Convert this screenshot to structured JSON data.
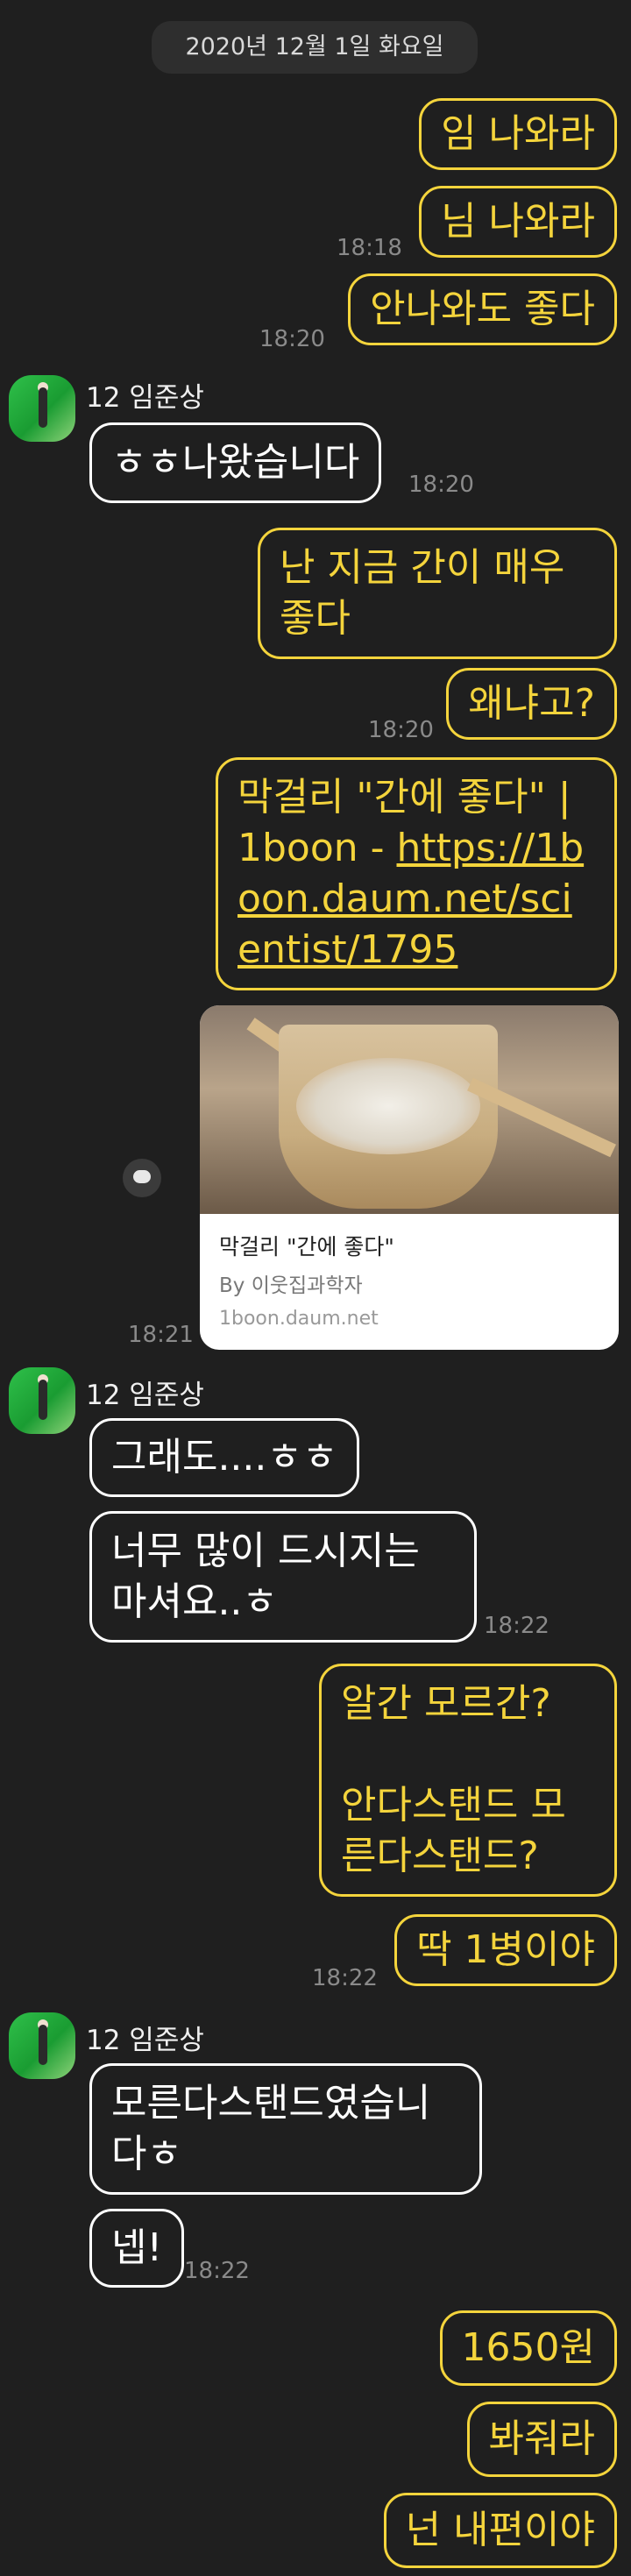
{
  "date_divider": "2020년 12월 1일 화요일",
  "contact": {
    "name": "12 임준상"
  },
  "messages": {
    "m1": "임 나와라",
    "m2": "님 나와라",
    "m3": "안나와도 좋다",
    "t1": "18:18",
    "t2": "18:20",
    "r1": "ㅎㅎ나왔습니다",
    "t3": "18:20",
    "m4": "난 지금 간이 매우 좋다",
    "m5": "왜냐고?",
    "t4": "18:20",
    "m6_text": "막걸리 \"간에 좋다\" | 1boon - ",
    "m6_link": "https://1boon.daum.net/scientist/1795",
    "link_card": {
      "title": "막걸리 \"간에 좋다\"",
      "by": "By 이웃집과학자",
      "domain": "1boon.daum.net"
    },
    "t5": "18:21",
    "r2": "그래도....ㅎㅎ",
    "r3": "너무 많이 드시지는 마셔요..ㅎ",
    "t6": "18:22",
    "m7": "알간 모르간?\n\n안다스탠드 모른다스탠드?",
    "m8": "딱 1병이야",
    "t7": "18:22",
    "r4": "모른다스탠드였습니다ㅎ",
    "r5": "넵!",
    "t8": "18:22",
    "m9": "1650원",
    "m10": "봐줘라",
    "m11": "넌 내편이야"
  },
  "colors": {
    "mine": "#f4d43c",
    "theirs": "#ffffff",
    "background": "#1f1f1f"
  }
}
